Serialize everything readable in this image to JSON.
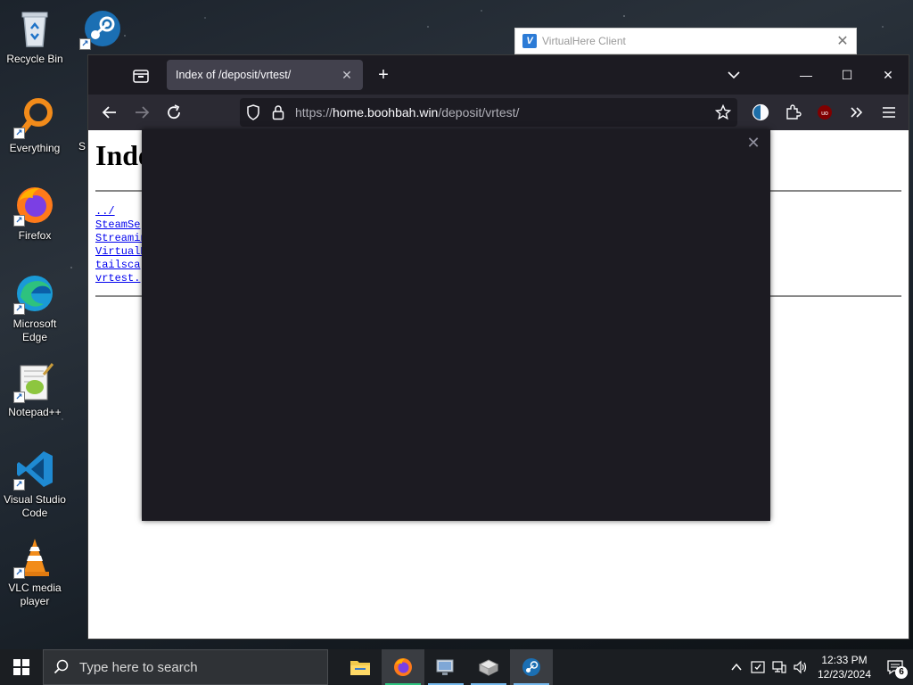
{
  "desktop": {
    "icons": [
      {
        "label": "Recycle Bin"
      },
      {
        "label": "Everything"
      },
      {
        "label": "Firefox"
      },
      {
        "label": "Microsoft Edge"
      },
      {
        "label": "Notepad++"
      },
      {
        "label": "Visual Studio Code"
      },
      {
        "label": "VLC media player"
      }
    ],
    "partial_icon_label": "S"
  },
  "virtualhere": {
    "title": "VirtualHere Client"
  },
  "browser": {
    "tab": {
      "title": "Index of /deposit/vrtest/"
    },
    "url": {
      "scheme": "https://",
      "host": "home.boohbah.win",
      "path": "/deposit/vrtest/"
    }
  },
  "page": {
    "heading_visible": "Inde",
    "links": [
      "../",
      "SteamSe",
      "Streamin",
      "VirtualH",
      "tailsca",
      "vrtest."
    ]
  },
  "taskbar": {
    "search_placeholder": "Type here to search",
    "clock_time": "12:33 PM",
    "clock_date": "12/23/2024",
    "notification_count": "6"
  },
  "colors": {
    "browser_chrome": "#1c1b22",
    "toolbar": "#2b2a33",
    "active_tab": "#42414d",
    "link": "#0000ee",
    "taskbar": "#1b1e22",
    "taskbar_accent": "#76b9ed"
  }
}
